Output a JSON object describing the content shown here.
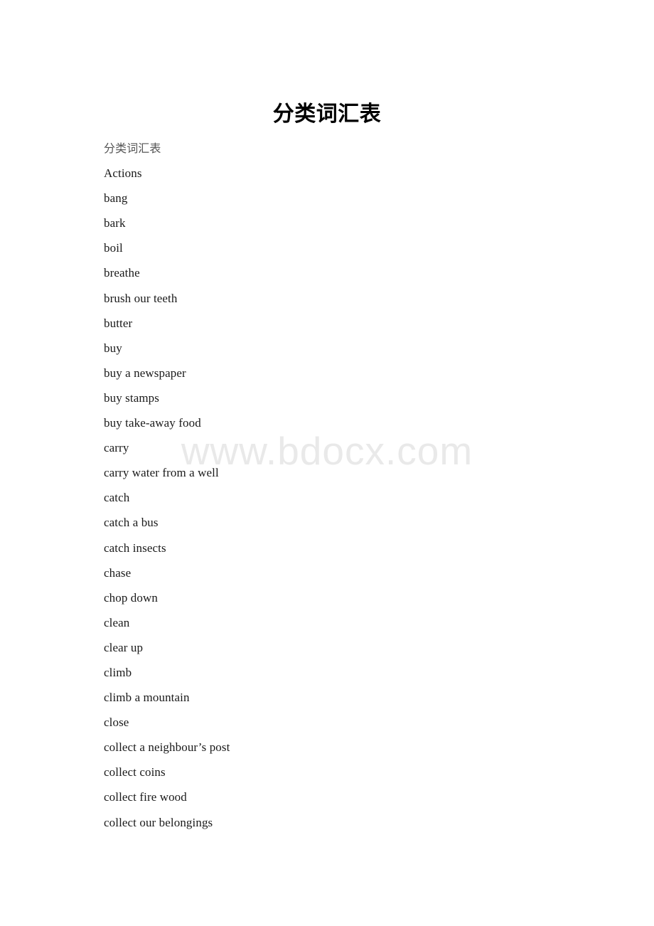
{
  "document": {
    "title": "分类词汇表",
    "watermark": "www.bdocx.com",
    "lines": [
      {
        "text": "分类词汇表",
        "style": "subtitle"
      },
      {
        "text": "Actions",
        "style": "body"
      },
      {
        "text": "bang",
        "style": "body"
      },
      {
        "text": "bark",
        "style": "body"
      },
      {
        "text": "boil",
        "style": "body"
      },
      {
        "text": "breathe",
        "style": "body"
      },
      {
        "text": "brush our teeth",
        "style": "body"
      },
      {
        "text": "butter",
        "style": "body"
      },
      {
        "text": "buy",
        "style": "body"
      },
      {
        "text": "buy a newspaper",
        "style": "body"
      },
      {
        "text": "buy stamps",
        "style": "body"
      },
      {
        "text": "buy take-away food",
        "style": "body"
      },
      {
        "text": "carry",
        "style": "body"
      },
      {
        "text": "carry water from a well",
        "style": "body"
      },
      {
        "text": "catch",
        "style": "body"
      },
      {
        "text": "catch a bus",
        "style": "body"
      },
      {
        "text": "catch insects",
        "style": "body"
      },
      {
        "text": "chase",
        "style": "body"
      },
      {
        "text": "chop down",
        "style": "body"
      },
      {
        "text": "clean",
        "style": "body"
      },
      {
        "text": "clear up",
        "style": "body"
      },
      {
        "text": "climb",
        "style": "body"
      },
      {
        "text": "climb a mountain",
        "style": "body"
      },
      {
        "text": "close",
        "style": "body"
      },
      {
        "text": "collect a neighbour’s post",
        "style": "body"
      },
      {
        "text": "collect coins",
        "style": "body"
      },
      {
        "text": "collect fire wood",
        "style": "body"
      },
      {
        "text": "collect our belongings",
        "style": "body"
      }
    ]
  }
}
